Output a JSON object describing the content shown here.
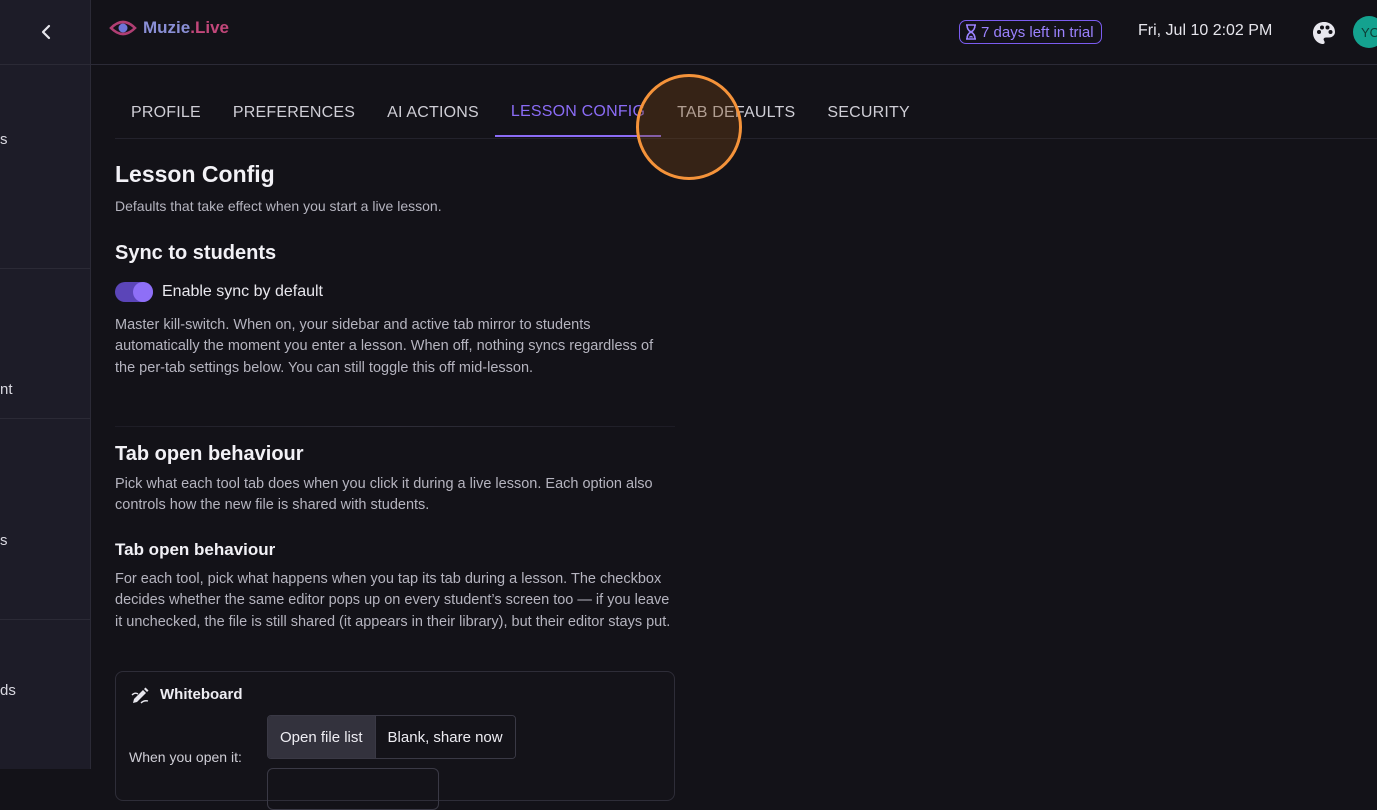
{
  "sidebar": {
    "items": [
      {
        "label": "s"
      },
      {
        "label": "nt"
      },
      {
        "label": "s"
      },
      {
        "label": "ds"
      }
    ]
  },
  "header": {
    "brand": "Muzie",
    "brand_suffix": ".Live",
    "trial_text": "7 days left in trial",
    "datetime": "Fri, Jul 10 2:02 PM",
    "avatar_initials": "YO"
  },
  "tabs": [
    {
      "label": "PROFILE"
    },
    {
      "label": "PREFERENCES"
    },
    {
      "label": "AI ACTIONS"
    },
    {
      "label": "LESSON CONFIG",
      "active": true
    },
    {
      "label": "TAB DEFAULTS"
    },
    {
      "label": "SECURITY"
    }
  ],
  "lesson_config": {
    "title": "Lesson Config",
    "subtitle": "Defaults that take effect when you start a live lesson.",
    "sync": {
      "heading": "Sync to students",
      "toggle_label": "Enable sync by default",
      "toggle_on": true,
      "description": "Master kill-switch. When on, your sidebar and active tab mirror to students automatically the moment you enter a lesson. When off, nothing syncs regardless of the per-tab settings below. You can still toggle this off mid-lesson."
    },
    "tab_open": {
      "heading": "Tab open behaviour",
      "description": "Pick what each tool tab does when you click it during a live lesson. Each option also controls how the new file is shared with students.",
      "sub_heading": "Tab open behaviour",
      "sub_description": "For each tool, pick what happens when you tap its tab during a lesson. The checkbox decides whether the same editor pops up on every student’s screen too — if you leave it unchecked, the file is still shared (it appears in their library), but their editor stays put."
    },
    "whiteboard": {
      "title": "Whiteboard",
      "open_label": "When you open it:",
      "options": [
        "Open file list",
        "Blank, share now"
      ],
      "selected": "Open file list"
    }
  },
  "colors": {
    "accent": "#8b6cf6",
    "background": "#131218",
    "sidebar": "#1d1c28",
    "highlight_ring": "#f5933a"
  }
}
